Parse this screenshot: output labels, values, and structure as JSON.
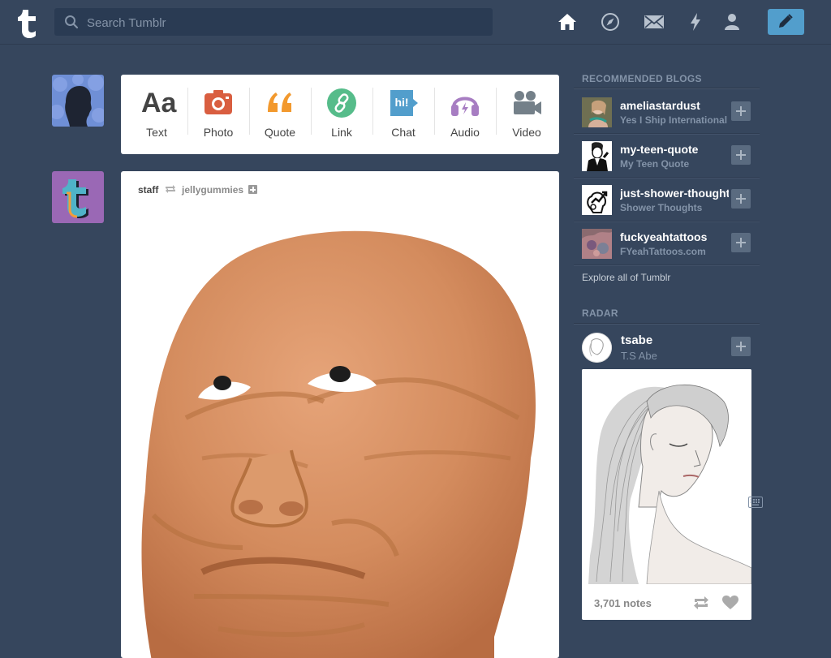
{
  "search": {
    "placeholder": "Search Tumblr"
  },
  "post_types": [
    {
      "label": "Text",
      "glyph": "Aa",
      "color": "#444444"
    },
    {
      "label": "Photo",
      "color": "#d95e40"
    },
    {
      "label": "Quote",
      "glyph": "❝",
      "color": "#f2992e"
    },
    {
      "label": "Link",
      "color": "#56bc8a"
    },
    {
      "label": "Chat",
      "glyph": "hi!",
      "color": "#529ecc"
    },
    {
      "label": "Audio",
      "color": "#a77dc2"
    },
    {
      "label": "Video",
      "color": "#748089"
    }
  ],
  "post": {
    "author": "staff",
    "reblogged_from": "jellygummies"
  },
  "sidebar": {
    "recommended_title": "RECOMMENDED BLOGS",
    "recommended": [
      {
        "name": "ameliastardust",
        "title": "Yes I Ship International"
      },
      {
        "name": "my-teen-quote",
        "title": "My Teen Quote"
      },
      {
        "name": "just-shower-thoughts",
        "title": "Shower Thoughts"
      },
      {
        "name": "fuckyeahtattoos",
        "title": "FYeahTattoos.com"
      }
    ],
    "explore": "Explore all of Tumblr",
    "radar_title": "RADAR",
    "radar": {
      "name": "tsabe",
      "title": "T.S Abe",
      "notes": "3,701 notes"
    }
  },
  "colors": {
    "background": "#36465d",
    "accent": "#529ecc"
  }
}
